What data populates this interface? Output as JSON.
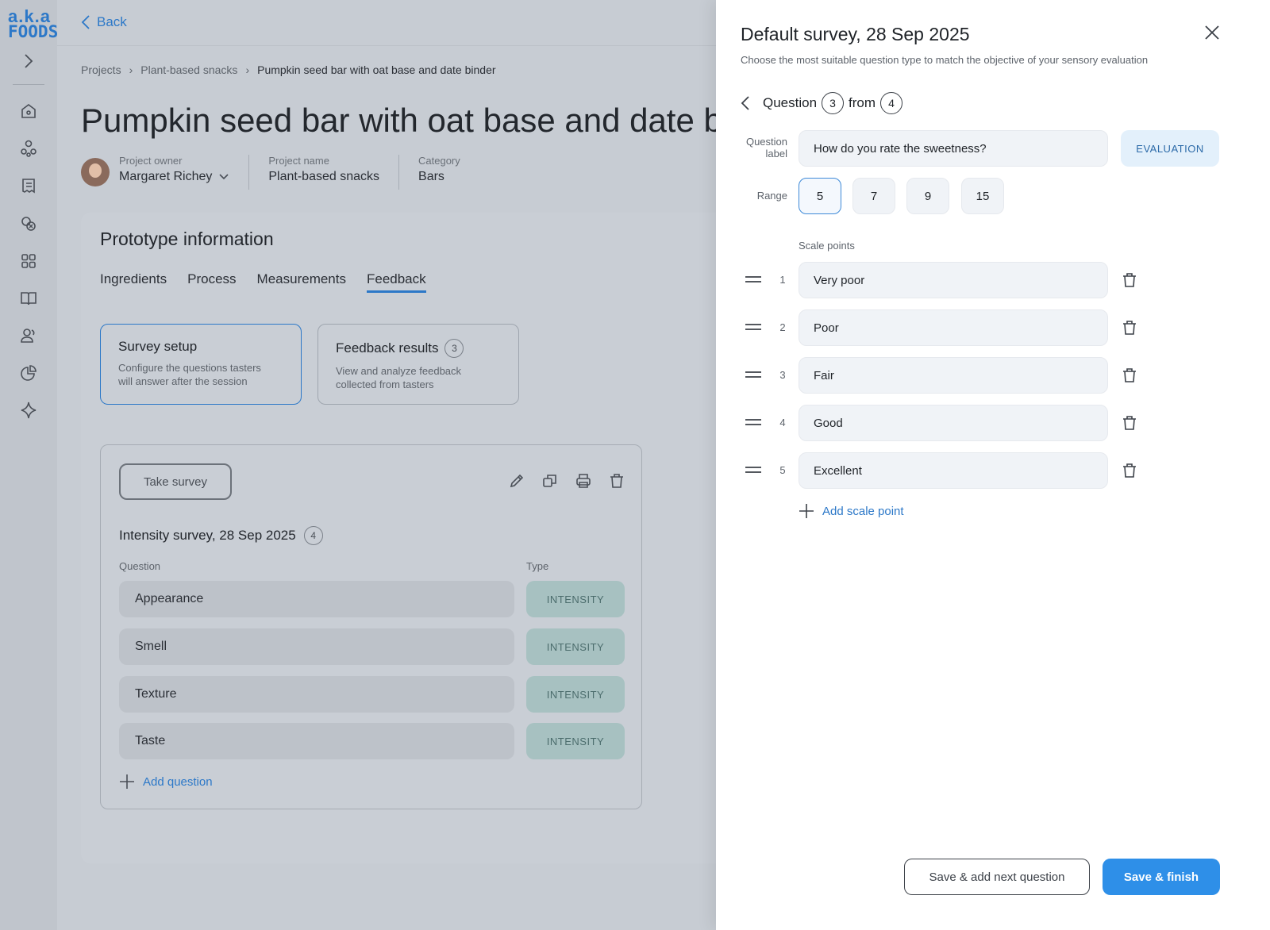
{
  "brand": {
    "logo_line1": "a.k.a",
    "logo_line2": "FOODS",
    "accent": "#2c78c8"
  },
  "rail": {
    "icons": [
      "chevron-right-icon",
      "home-icon",
      "network-icon",
      "receipt-icon",
      "tasks-icon",
      "grid-icon",
      "book-icon",
      "users-icon",
      "pie-chart-icon",
      "sparkle-icon"
    ]
  },
  "topbar": {
    "back_label": "Back"
  },
  "breadcrumb": {
    "items": [
      "Projects",
      "Plant-based snacks",
      "Pumpkin seed bar with oat base and date binder"
    ],
    "separator": "›"
  },
  "project": {
    "title": "Pumpkin seed bar with oat base and date binder",
    "owner_label": "Project owner",
    "owner": "Margaret Richey",
    "name_label": "Project name",
    "name": "Plant-based snacks",
    "category_label": "Category",
    "category": "Bars"
  },
  "prototype": {
    "title": "Prototype information",
    "tabs": [
      {
        "label": "Ingredients"
      },
      {
        "label": "Process"
      },
      {
        "label": "Measurements"
      },
      {
        "label": "Feedback",
        "active": true
      }
    ],
    "tiles": [
      {
        "title": "Survey setup",
        "desc1": "Configure the questions tasters",
        "desc2": "will answer after the session"
      },
      {
        "title": "Feedback results",
        "count": "3",
        "desc1": "View and analyze feedback",
        "desc2": "collected from tasters"
      }
    ]
  },
  "survey": {
    "take_label": "Take survey",
    "name": "Intensity survey, 28 Sep 2025",
    "count": "4",
    "col_question": "Question",
    "col_type": "Type",
    "questions": [
      {
        "label": "Appearance",
        "type": "INTENSITY"
      },
      {
        "label": "Smell",
        "type": "INTENSITY"
      },
      {
        "label": "Texture",
        "type": "INTENSITY"
      },
      {
        "label": "Taste",
        "type": "INTENSITY"
      }
    ],
    "add_label": "Add question"
  },
  "drawer": {
    "title": "Default survey, 28 Sep 2025",
    "subtitle": "Choose the most suitable question type to match the objective of your sensory evaluation",
    "nav": {
      "word": "Question",
      "current": "3",
      "from": "from",
      "total": "4"
    },
    "label_line1": "Question",
    "label_line2": "label",
    "question_value": "How do you rate the sweetness?",
    "question_type": "EVALUATION",
    "range_label": "Range",
    "range_options": [
      "5",
      "7",
      "9",
      "15"
    ],
    "range_selected": "5",
    "scale_header": "Scale points",
    "scale_points": [
      {
        "n": "1",
        "label": "Very poor"
      },
      {
        "n": "2",
        "label": "Poor"
      },
      {
        "n": "3",
        "label": "Fair"
      },
      {
        "n": "4",
        "label": "Good"
      },
      {
        "n": "5",
        "label": "Excellent"
      }
    ],
    "add_scale_label": "Add scale point",
    "btn_next": "Save & add next question",
    "btn_finish": "Save & finish"
  }
}
